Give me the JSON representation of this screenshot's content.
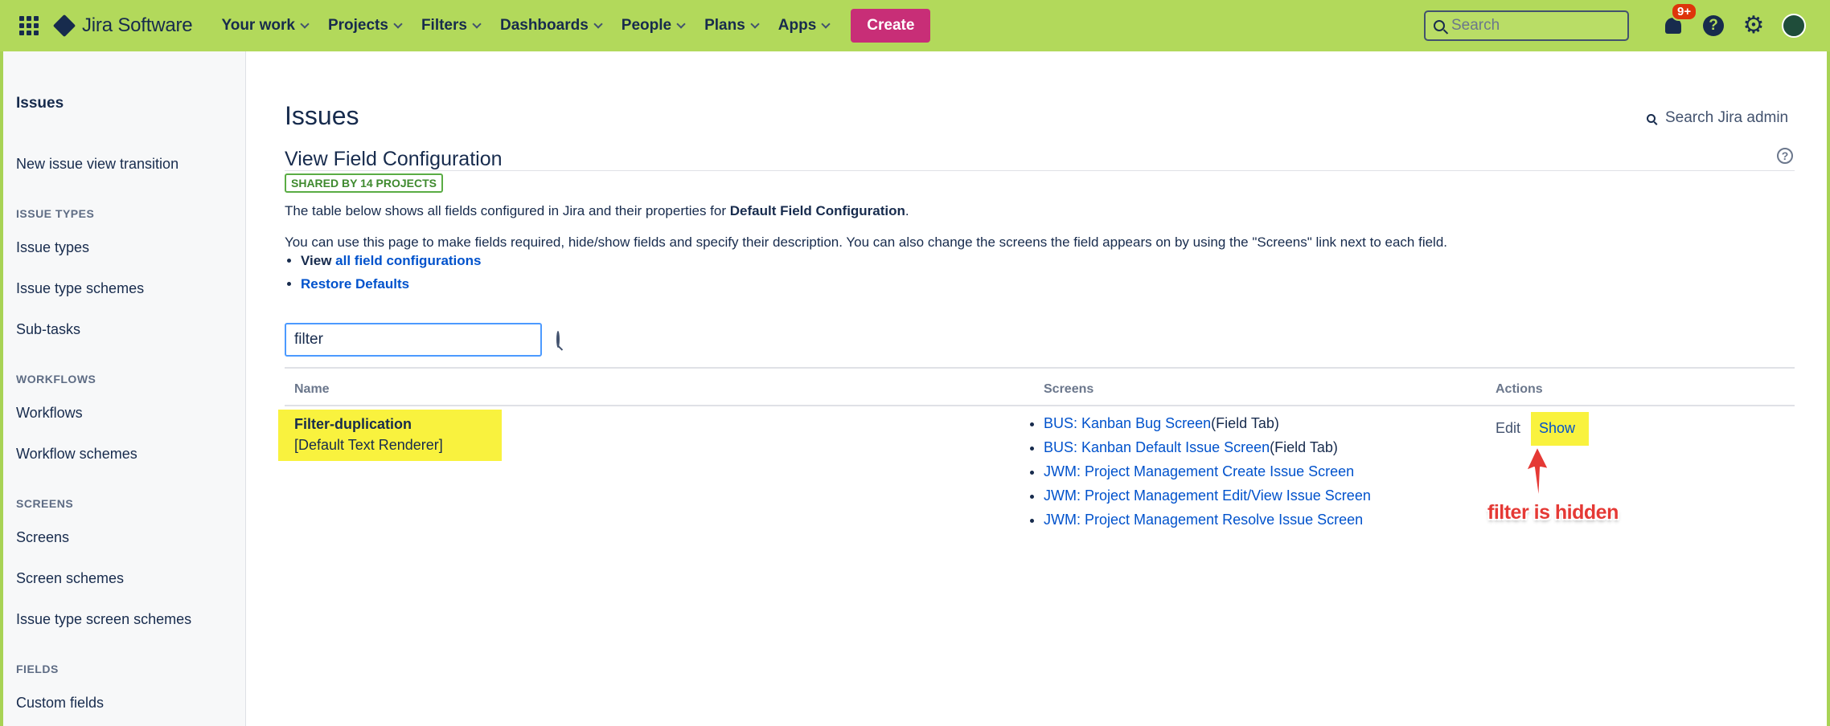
{
  "topnav": {
    "product_name": "Jira Software",
    "menu": [
      "Your work",
      "Projects",
      "Filters",
      "Dashboards",
      "People",
      "Plans",
      "Apps"
    ],
    "create_label": "Create",
    "search_placeholder": "Search",
    "notification_count": "9+",
    "help_glyph": "?",
    "accent_color": "#b2d95b",
    "create_color": "#c82e77"
  },
  "sidebar": {
    "title": "Issues",
    "top_link": "New issue view transition",
    "sections": [
      {
        "heading": "ISSUE TYPES",
        "items": [
          "Issue types",
          "Issue type schemes",
          "Sub-tasks"
        ]
      },
      {
        "heading": "WORKFLOWS",
        "items": [
          "Workflows",
          "Workflow schemes"
        ]
      },
      {
        "heading": "SCREENS",
        "items": [
          "Screens",
          "Screen schemes",
          "Issue type screen schemes"
        ]
      },
      {
        "heading": "FIELDS",
        "items": [
          "Custom fields"
        ]
      }
    ]
  },
  "main": {
    "page_title": "Issues",
    "admin_search": "Search Jira admin",
    "section_title": "View Field Configuration",
    "shared_lozenge": "SHARED BY 14 PROJECTS",
    "desc1_prefix": "The table below shows all fields configured in Jira and their properties for ",
    "desc1_bold": "Default Field Configuration",
    "desc1_suffix": ".",
    "desc2": "You can use this page to make fields required, hide/show fields and specify their description. You can also change the screens the field appears on by using the \"Screens\" link next to each field.",
    "bullet_view_prefix": "View ",
    "bullet_view_link": "all field configurations",
    "bullet_restore": "Restore Defaults",
    "filter_value": "filter",
    "table": {
      "headers": {
        "name": "Name",
        "screens": "Screens",
        "actions": "Actions"
      },
      "rows": [
        {
          "name": "Filter-duplication",
          "renderer": "[Default Text Renderer]",
          "screens": [
            {
              "link": "BUS: Kanban Bug Screen",
              "suffix": "(Field Tab)"
            },
            {
              "link": "BUS: Kanban Default Issue Screen",
              "suffix": "(Field Tab)"
            },
            {
              "link": "JWM: Project Management Create Issue Screen",
              "suffix": ""
            },
            {
              "link": "JWM: Project Management Edit/View Issue Screen",
              "suffix": ""
            },
            {
              "link": "JWM: Project Management Resolve Issue Screen",
              "suffix": ""
            }
          ],
          "actions": {
            "edit": "Edit",
            "show": "Show"
          }
        }
      ]
    },
    "annotation": "filter is hidden",
    "highlight_color": "#f9f23e",
    "annotation_color": "#e53935"
  }
}
